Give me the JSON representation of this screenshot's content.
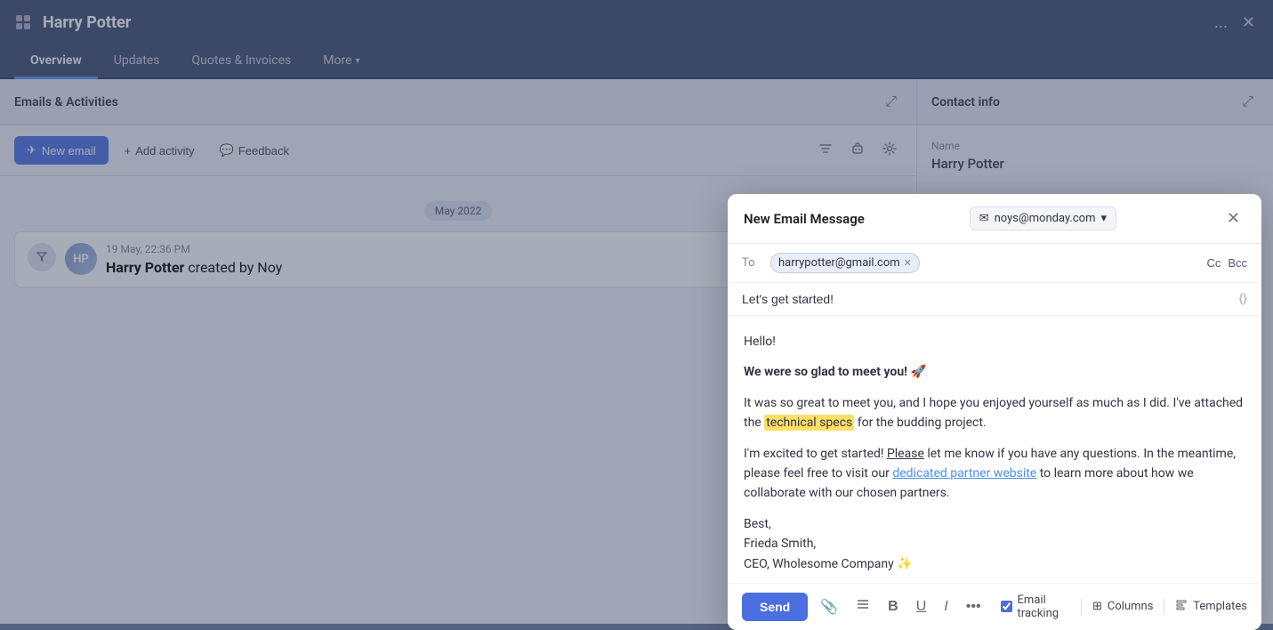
{
  "topbar": {
    "title": "Harry Potter",
    "icon": "🏠",
    "more_label": "...",
    "close_label": "✕"
  },
  "nav": {
    "tabs": [
      {
        "label": "Overview",
        "active": true
      },
      {
        "label": "Updates",
        "active": false
      },
      {
        "label": "Quotes & Invoices",
        "active": false
      },
      {
        "label": "More",
        "active": false,
        "has_dropdown": true
      }
    ]
  },
  "left_panel": {
    "title": "Emails & Activities",
    "toolbar": {
      "new_email_label": "New email",
      "add_activity_label": "Add activity",
      "feedback_label": "Feedback"
    },
    "timeline": {
      "date_group": "May 2022",
      "entries": [
        {
          "date": "19 May, 22:36 PM",
          "text": "Harry Potter created by Noy",
          "name": "Harry Potter",
          "creator": "Noy"
        }
      ]
    }
  },
  "right_panel": {
    "title": "Contact info",
    "name_label": "Name",
    "name_value": "Harry Potter"
  },
  "modal": {
    "title": "New Email Message",
    "from_email": "noys@monday.com",
    "from_icon": "✉",
    "dropdown_icon": "▾",
    "close_label": "✕",
    "to_label": "To",
    "to_recipient": "harrypotter@gmail.com",
    "cc_label": "Cc",
    "bcc_label": "Bcc",
    "subject": "Let's get started!",
    "subject_icon": "{}",
    "body_greeting": "Hello!",
    "body_bold": "We were so glad to meet you! 🚀",
    "body_p1_pre": "It was so great to meet you, and I hope you enjoyed yourself as much as I did. I've attached the ",
    "body_highlight": "technical specs",
    "body_p1_post": " for the budding project.",
    "body_p2_pre": "I'm excited to get started! ",
    "body_p2_link1": "Please",
    "body_p2_mid": " let me know if you have any questions. In the meantime, please feel free to visit our ",
    "body_p2_link2": "dedicated partner website",
    "body_p2_post": " to learn more about how we collaborate with our chosen partners.",
    "body_sign1": "Best,",
    "body_sign2": "Frieda Smith,",
    "body_sign3": "CEO, Wholesome Company ✨",
    "footer": {
      "send_label": "Send",
      "attach_icon": "📎",
      "list_icon": "☰",
      "bold_icon": "B",
      "underline_icon": "U",
      "italic_icon": "I",
      "more_icon": "•••",
      "tracking_label": "Email tracking",
      "tracking_checked": true,
      "columns_label": "Columns",
      "templates_label": "Templates"
    }
  }
}
